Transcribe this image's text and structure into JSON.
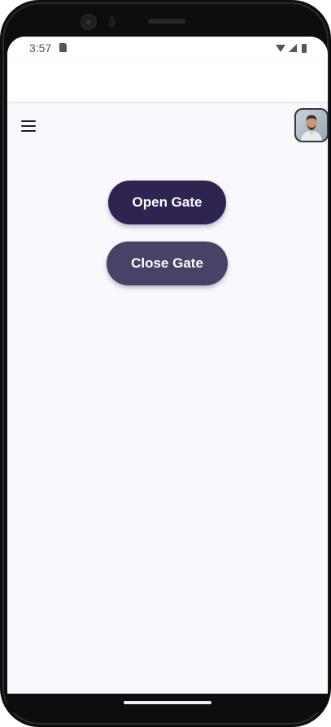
{
  "status_bar": {
    "time": "3:57",
    "icons": [
      "sd-card-icon",
      "wifi-icon",
      "signal-icon",
      "battery-icon"
    ]
  },
  "toolbar": {
    "menu_icon": "hamburger-menu-icon",
    "avatar_icon": "user-avatar"
  },
  "actions": {
    "open_gate_label": "Open Gate",
    "close_gate_label": "Close Gate"
  },
  "colors": {
    "open_button": "#2f2352",
    "close_button": "#474366",
    "background": "#f9f8fc"
  }
}
